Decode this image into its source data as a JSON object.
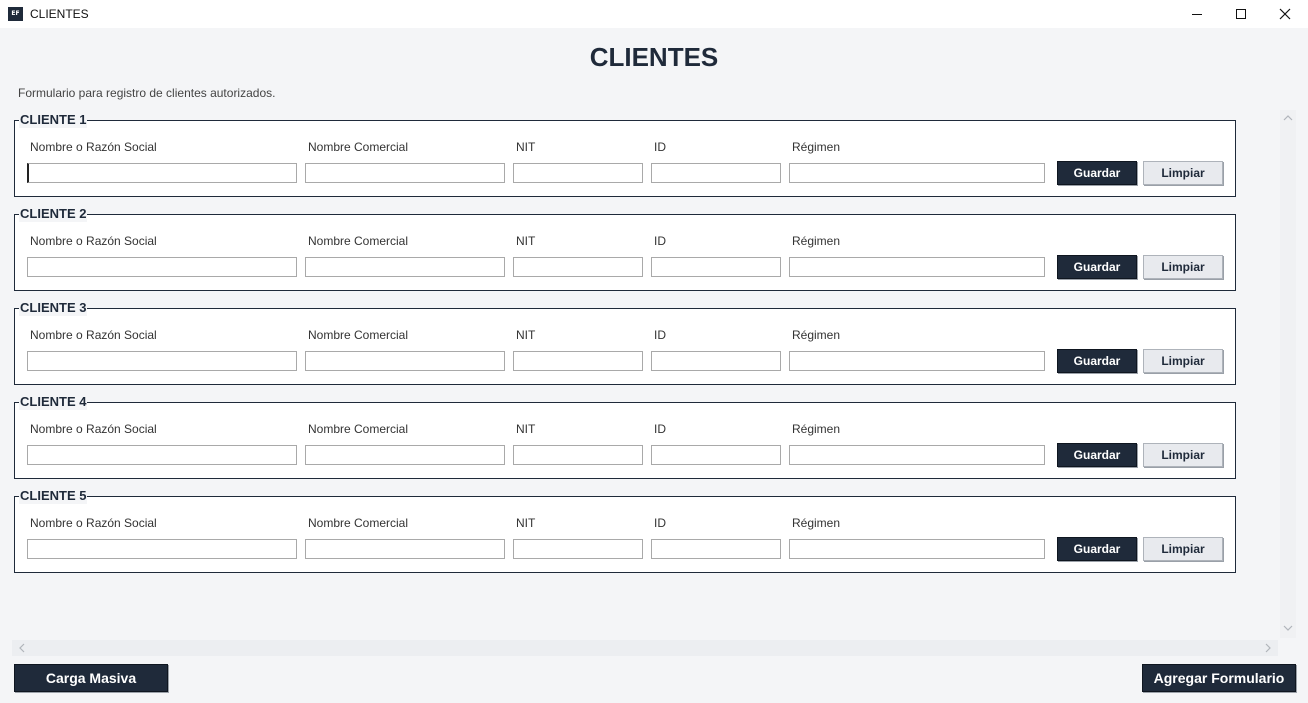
{
  "window": {
    "icon_text": "EF",
    "title": "CLIENTES"
  },
  "header": {
    "title": "CLIENTES",
    "subtitle": "Formulario para registro de clientes autorizados."
  },
  "fields": {
    "razon_social": "Nombre o Razón Social",
    "nombre_comercial": "Nombre Comercial",
    "nit": "NIT",
    "id": "ID",
    "regimen": "Régimen"
  },
  "buttons": {
    "guardar": "Guardar",
    "limpiar": "Limpiar"
  },
  "clients": [
    {
      "legend": "CLIENTE 1"
    },
    {
      "legend": "CLIENTE 2"
    },
    {
      "legend": "CLIENTE 3"
    },
    {
      "legend": "CLIENTE 4"
    },
    {
      "legend": "CLIENTE 5"
    }
  ],
  "footer": {
    "carga_masiva": "Carga Masiva",
    "agregar_formulario": "Agregar Formulario"
  }
}
